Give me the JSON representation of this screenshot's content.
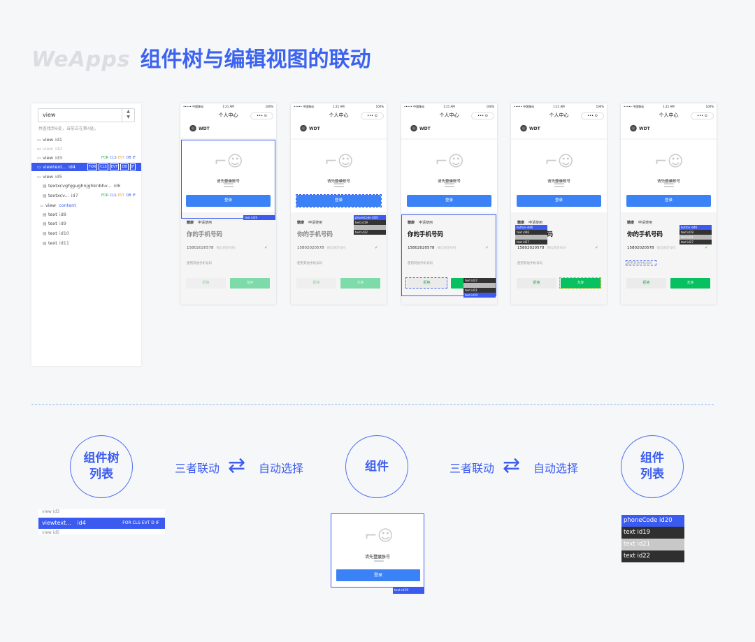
{
  "title": {
    "brand": "WeApps",
    "text": "组件树与编辑视图的联动"
  },
  "tree": {
    "search_value": "view",
    "hint": "共查找到6处，当前正在第4处。",
    "rows": [
      {
        "icon": "view",
        "label": "view",
        "id": "id1",
        "tags": ""
      },
      {
        "icon": "view",
        "label": "view",
        "id": "id2",
        "tags": "",
        "dim": true
      },
      {
        "icon": "view",
        "label": "view",
        "id": "id3",
        "tags": "FOR CLS EVT DB IF"
      },
      {
        "icon": "view",
        "label": "viewtext...",
        "id": "id4",
        "tags": "FOR CLS EVT DB IF",
        "selected": true
      },
      {
        "icon": "view",
        "label": "view",
        "id": "id5",
        "tags": ""
      },
      {
        "icon": "text",
        "label": "textxcvghjgughnjghknbhv...",
        "id": "id6",
        "tags": ""
      },
      {
        "icon": "text",
        "label": "textxcv...",
        "id": "id7",
        "tags": "FOR CLS EVT DB IF"
      },
      {
        "icon": "view",
        "label": "view",
        "id": "content",
        "tags": ""
      },
      {
        "icon": "text",
        "label": "text",
        "id": "id8",
        "tags": ""
      },
      {
        "icon": "text",
        "label": "text",
        "id": "id9",
        "tags": ""
      },
      {
        "icon": "text",
        "label": "text",
        "id": "id10",
        "tags": ""
      },
      {
        "icon": "text",
        "label": "text",
        "id": "id11",
        "tags": ""
      }
    ]
  },
  "phone": {
    "carrier": "••••• 中国移动",
    "time": "1:21 AM",
    "battery": "100%",
    "nav_title": "个人中心",
    "user_name": "WDT",
    "login_hint": "请先登录账号",
    "login_button": "登录",
    "auth_app": "糖康",
    "auth_apply": "申请使用",
    "auth_title": "你的手机号码",
    "phone_number": "15802020578",
    "phone_note": "微信绑定号码",
    "other_phone": "使用其他手机号码",
    "reject": "拒绝",
    "allow": "允许",
    "labels": {
      "p1": "text id19",
      "p2a": "phoneCode id20",
      "p2b": "text id19",
      "p2c": "text id22",
      "p3a": "text id27",
      "p3b": "text id21",
      "p3c": "text id19",
      "p4a": "button id46",
      "p4b": "text id46",
      "p4c": "text id27",
      "p5a": "button id46",
      "p5b": "text id19",
      "p5c": "text id21",
      "p5d": "text id27"
    }
  },
  "flow": {
    "circle1": [
      "组件树",
      "列表"
    ],
    "link1": "三者联动",
    "auto1": "自动选择",
    "circle2": "组件",
    "link2": "三者联动",
    "auto2": "自动选择",
    "circle3": [
      "组件",
      "列表"
    ]
  },
  "bottom": {
    "tree_selected": "viewtext...",
    "tree_selected_id": "id4",
    "tree_tags": "FOR CLS EVT D IF",
    "tree_ghost_top": "view id3",
    "tree_ghost_bottom": "view id5",
    "comp_hint": "请先登录账号",
    "comp_button": "登录",
    "comp_label": "text id19",
    "list": [
      {
        "label": "phoneCode id20",
        "style": "h"
      },
      {
        "label": "text id19",
        "style": ""
      },
      {
        "label": "text id21",
        "style": "g"
      },
      {
        "label": "text id22",
        "style": ""
      }
    ]
  }
}
